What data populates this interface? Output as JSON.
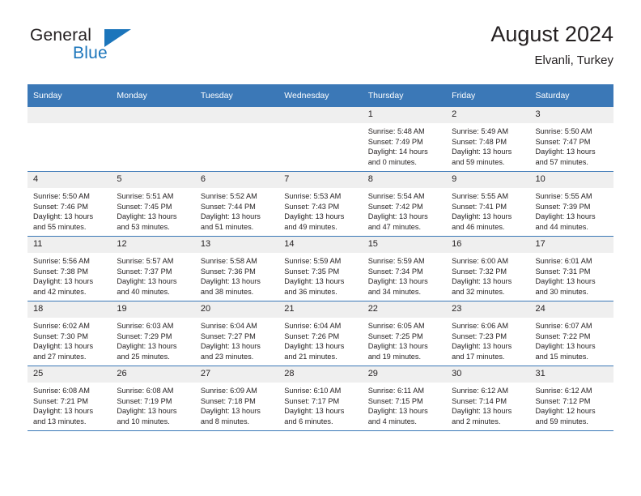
{
  "brand": {
    "name_part1": "General",
    "name_part2": "Blue",
    "triangle_color": "#1b75bb",
    "text_color": "#231f20"
  },
  "header": {
    "title": "August 2024",
    "location": "Elvanli, Turkey"
  },
  "theme": {
    "header_row_bg": "#3b78b7",
    "header_row_text": "#ffffff",
    "day_number_bg": "#efefef",
    "cell_bg": "#ffffff",
    "border": "#3b78b7",
    "body_text": "#231f20"
  },
  "labels": {
    "sunrise_prefix": "Sunrise:",
    "sunset_prefix": "Sunset:",
    "daylight_prefix": "Daylight:"
  },
  "weekdays": [
    "Sunday",
    "Monday",
    "Tuesday",
    "Wednesday",
    "Thursday",
    "Friday",
    "Saturday"
  ],
  "weeks": [
    [
      {
        "day": "",
        "empty": true
      },
      {
        "day": "",
        "empty": true
      },
      {
        "day": "",
        "empty": true
      },
      {
        "day": "",
        "empty": true
      },
      {
        "day": "1",
        "sunrise": "Sunrise: 5:48 AM",
        "sunset": "Sunset: 7:49 PM",
        "daylight_line1": "Daylight: 14 hours",
        "daylight_line2": "and 0 minutes."
      },
      {
        "day": "2",
        "sunrise": "Sunrise: 5:49 AM",
        "sunset": "Sunset: 7:48 PM",
        "daylight_line1": "Daylight: 13 hours",
        "daylight_line2": "and 59 minutes."
      },
      {
        "day": "3",
        "sunrise": "Sunrise: 5:50 AM",
        "sunset": "Sunset: 7:47 PM",
        "daylight_line1": "Daylight: 13 hours",
        "daylight_line2": "and 57 minutes."
      }
    ],
    [
      {
        "day": "4",
        "sunrise": "Sunrise: 5:50 AM",
        "sunset": "Sunset: 7:46 PM",
        "daylight_line1": "Daylight: 13 hours",
        "daylight_line2": "and 55 minutes."
      },
      {
        "day": "5",
        "sunrise": "Sunrise: 5:51 AM",
        "sunset": "Sunset: 7:45 PM",
        "daylight_line1": "Daylight: 13 hours",
        "daylight_line2": "and 53 minutes."
      },
      {
        "day": "6",
        "sunrise": "Sunrise: 5:52 AM",
        "sunset": "Sunset: 7:44 PM",
        "daylight_line1": "Daylight: 13 hours",
        "daylight_line2": "and 51 minutes."
      },
      {
        "day": "7",
        "sunrise": "Sunrise: 5:53 AM",
        "sunset": "Sunset: 7:43 PM",
        "daylight_line1": "Daylight: 13 hours",
        "daylight_line2": "and 49 minutes."
      },
      {
        "day": "8",
        "sunrise": "Sunrise: 5:54 AM",
        "sunset": "Sunset: 7:42 PM",
        "daylight_line1": "Daylight: 13 hours",
        "daylight_line2": "and 47 minutes."
      },
      {
        "day": "9",
        "sunrise": "Sunrise: 5:55 AM",
        "sunset": "Sunset: 7:41 PM",
        "daylight_line1": "Daylight: 13 hours",
        "daylight_line2": "and 46 minutes."
      },
      {
        "day": "10",
        "sunrise": "Sunrise: 5:55 AM",
        "sunset": "Sunset: 7:39 PM",
        "daylight_line1": "Daylight: 13 hours",
        "daylight_line2": "and 44 minutes."
      }
    ],
    [
      {
        "day": "11",
        "sunrise": "Sunrise: 5:56 AM",
        "sunset": "Sunset: 7:38 PM",
        "daylight_line1": "Daylight: 13 hours",
        "daylight_line2": "and 42 minutes."
      },
      {
        "day": "12",
        "sunrise": "Sunrise: 5:57 AM",
        "sunset": "Sunset: 7:37 PM",
        "daylight_line1": "Daylight: 13 hours",
        "daylight_line2": "and 40 minutes."
      },
      {
        "day": "13",
        "sunrise": "Sunrise: 5:58 AM",
        "sunset": "Sunset: 7:36 PM",
        "daylight_line1": "Daylight: 13 hours",
        "daylight_line2": "and 38 minutes."
      },
      {
        "day": "14",
        "sunrise": "Sunrise: 5:59 AM",
        "sunset": "Sunset: 7:35 PM",
        "daylight_line1": "Daylight: 13 hours",
        "daylight_line2": "and 36 minutes."
      },
      {
        "day": "15",
        "sunrise": "Sunrise: 5:59 AM",
        "sunset": "Sunset: 7:34 PM",
        "daylight_line1": "Daylight: 13 hours",
        "daylight_line2": "and 34 minutes."
      },
      {
        "day": "16",
        "sunrise": "Sunrise: 6:00 AM",
        "sunset": "Sunset: 7:32 PM",
        "daylight_line1": "Daylight: 13 hours",
        "daylight_line2": "and 32 minutes."
      },
      {
        "day": "17",
        "sunrise": "Sunrise: 6:01 AM",
        "sunset": "Sunset: 7:31 PM",
        "daylight_line1": "Daylight: 13 hours",
        "daylight_line2": "and 30 minutes."
      }
    ],
    [
      {
        "day": "18",
        "sunrise": "Sunrise: 6:02 AM",
        "sunset": "Sunset: 7:30 PM",
        "daylight_line1": "Daylight: 13 hours",
        "daylight_line2": "and 27 minutes."
      },
      {
        "day": "19",
        "sunrise": "Sunrise: 6:03 AM",
        "sunset": "Sunset: 7:29 PM",
        "daylight_line1": "Daylight: 13 hours",
        "daylight_line2": "and 25 minutes."
      },
      {
        "day": "20",
        "sunrise": "Sunrise: 6:04 AM",
        "sunset": "Sunset: 7:27 PM",
        "daylight_line1": "Daylight: 13 hours",
        "daylight_line2": "and 23 minutes."
      },
      {
        "day": "21",
        "sunrise": "Sunrise: 6:04 AM",
        "sunset": "Sunset: 7:26 PM",
        "daylight_line1": "Daylight: 13 hours",
        "daylight_line2": "and 21 minutes."
      },
      {
        "day": "22",
        "sunrise": "Sunrise: 6:05 AM",
        "sunset": "Sunset: 7:25 PM",
        "daylight_line1": "Daylight: 13 hours",
        "daylight_line2": "and 19 minutes."
      },
      {
        "day": "23",
        "sunrise": "Sunrise: 6:06 AM",
        "sunset": "Sunset: 7:23 PM",
        "daylight_line1": "Daylight: 13 hours",
        "daylight_line2": "and 17 minutes."
      },
      {
        "day": "24",
        "sunrise": "Sunrise: 6:07 AM",
        "sunset": "Sunset: 7:22 PM",
        "daylight_line1": "Daylight: 13 hours",
        "daylight_line2": "and 15 minutes."
      }
    ],
    [
      {
        "day": "25",
        "sunrise": "Sunrise: 6:08 AM",
        "sunset": "Sunset: 7:21 PM",
        "daylight_line1": "Daylight: 13 hours",
        "daylight_line2": "and 13 minutes."
      },
      {
        "day": "26",
        "sunrise": "Sunrise: 6:08 AM",
        "sunset": "Sunset: 7:19 PM",
        "daylight_line1": "Daylight: 13 hours",
        "daylight_line2": "and 10 minutes."
      },
      {
        "day": "27",
        "sunrise": "Sunrise: 6:09 AM",
        "sunset": "Sunset: 7:18 PM",
        "daylight_line1": "Daylight: 13 hours",
        "daylight_line2": "and 8 minutes."
      },
      {
        "day": "28",
        "sunrise": "Sunrise: 6:10 AM",
        "sunset": "Sunset: 7:17 PM",
        "daylight_line1": "Daylight: 13 hours",
        "daylight_line2": "and 6 minutes."
      },
      {
        "day": "29",
        "sunrise": "Sunrise: 6:11 AM",
        "sunset": "Sunset: 7:15 PM",
        "daylight_line1": "Daylight: 13 hours",
        "daylight_line2": "and 4 minutes."
      },
      {
        "day": "30",
        "sunrise": "Sunrise: 6:12 AM",
        "sunset": "Sunset: 7:14 PM",
        "daylight_line1": "Daylight: 13 hours",
        "daylight_line2": "and 2 minutes."
      },
      {
        "day": "31",
        "sunrise": "Sunrise: 6:12 AM",
        "sunset": "Sunset: 7:12 PM",
        "daylight_line1": "Daylight: 12 hours",
        "daylight_line2": "and 59 minutes."
      }
    ]
  ]
}
